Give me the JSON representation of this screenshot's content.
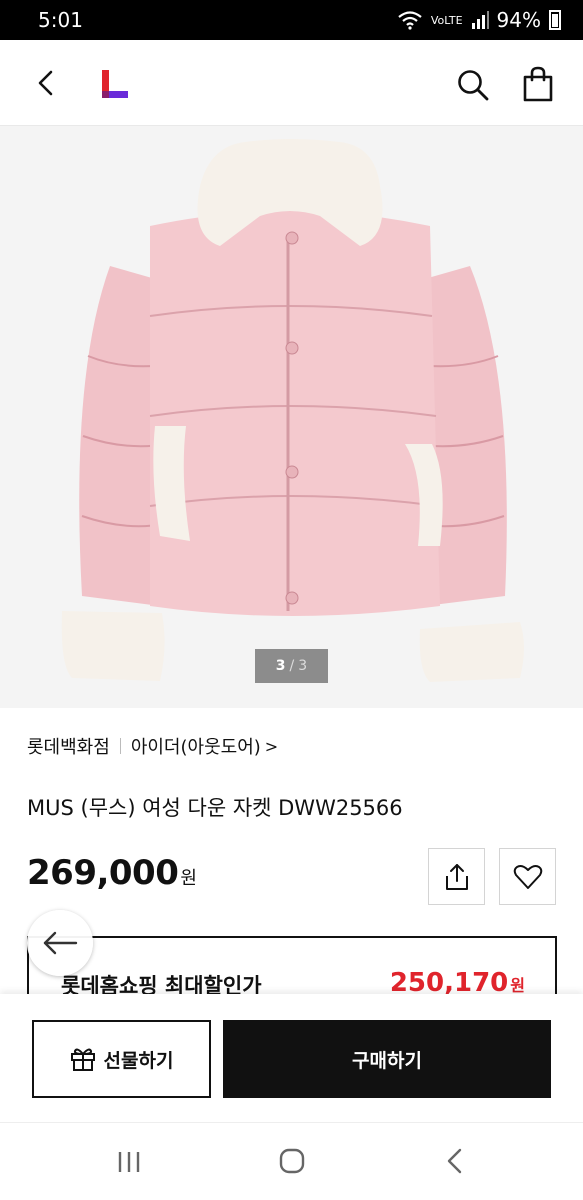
{
  "status_bar": {
    "time": "5:01",
    "network": "VoLTE",
    "battery": "94%",
    "icons": [
      "wifi-icon",
      "signal-icon",
      "battery-icon"
    ]
  },
  "top_nav": {
    "icons": [
      "back-arrow-icon",
      "lotte-logo",
      "search-icon",
      "shopping-bag-icon"
    ],
    "logo_colors": [
      "#e0242c",
      "#6a2bd9"
    ]
  },
  "gallery": {
    "current": "3",
    "separator": "/",
    "total": "3"
  },
  "product": {
    "store": "롯데백화점",
    "category": "아이더(아웃도어)",
    "category_chevron": ">",
    "name": "MUS (무스) 여성 다운 자켓 DWW25566",
    "price": "269,000",
    "currency": "원",
    "action_icons": [
      "share-icon",
      "heart-icon"
    ]
  },
  "discount": {
    "label": "롯데홈쇼핑 최대할인가",
    "price": "250,170",
    "currency": "원",
    "accent_color": "#e0242c"
  },
  "bottom_bar": {
    "gift_label": "선물하기",
    "buy_label": "구매하기",
    "icons": [
      "gift-icon"
    ]
  },
  "float_back": {
    "icon": "arrow-left-icon"
  },
  "system_nav": {
    "icons": [
      "recent-apps-icon",
      "home-icon",
      "system-back-icon"
    ]
  }
}
